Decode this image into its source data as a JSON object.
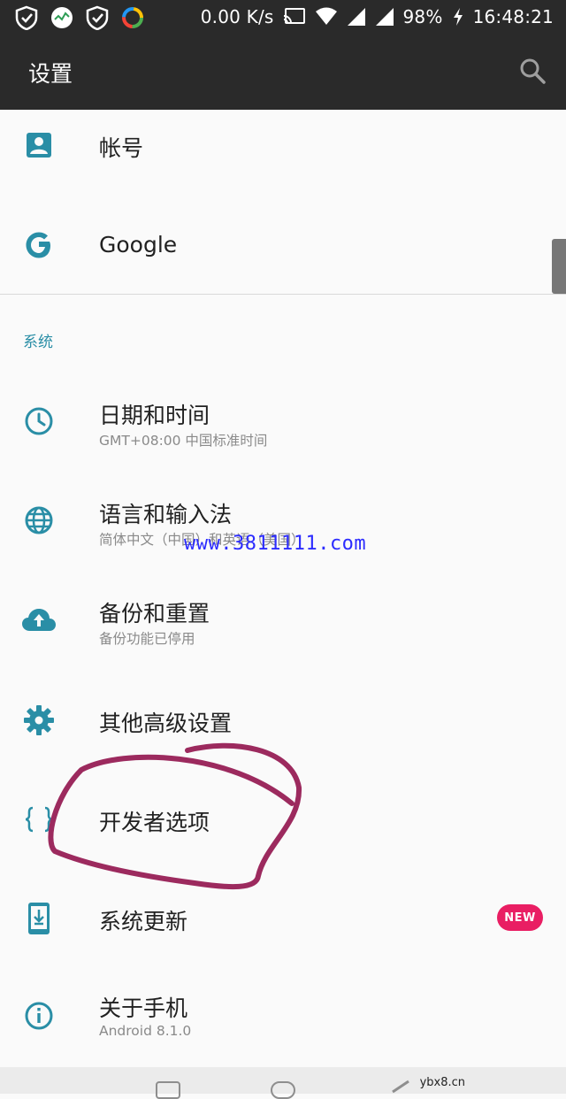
{
  "status_bar": {
    "net_speed": "0.00 K/s",
    "battery": "98%",
    "time": "16:48:21"
  },
  "app_bar": {
    "title": "设置",
    "search_icon": "search-icon"
  },
  "items": [
    {
      "label": "帐号",
      "icon": "account-box-icon"
    },
    {
      "label": "Google",
      "icon": "google-g-icon"
    }
  ],
  "section_title": "系统",
  "system_items": [
    {
      "label": "日期和时间",
      "sublabel": "GMT+08:00 中国标准时间",
      "icon": "clock-icon"
    },
    {
      "label": "语言和输入法",
      "sublabel": "简体中文（中国）和英语（美国）",
      "icon": "globe-icon"
    },
    {
      "label": "备份和重置",
      "sublabel": "备份功能已停用",
      "icon": "cloud-upload-icon"
    },
    {
      "label": "其他高级设置",
      "icon": "gear-icon"
    },
    {
      "label": "开发者选项",
      "icon": "braces-icon"
    },
    {
      "label": "系统更新",
      "icon": "system-update-icon",
      "badge": "NEW"
    },
    {
      "label": "关于手机",
      "sublabel": "Android 8.1.0",
      "icon": "info-icon"
    }
  ],
  "watermark": "www.3811111.com",
  "site_label": "ybx8.cn",
  "colors": {
    "accent": "#2a8ea6",
    "app_bar": "#2a2a2a",
    "badge": "#e91e63",
    "annotation": "#9c2a5e"
  }
}
